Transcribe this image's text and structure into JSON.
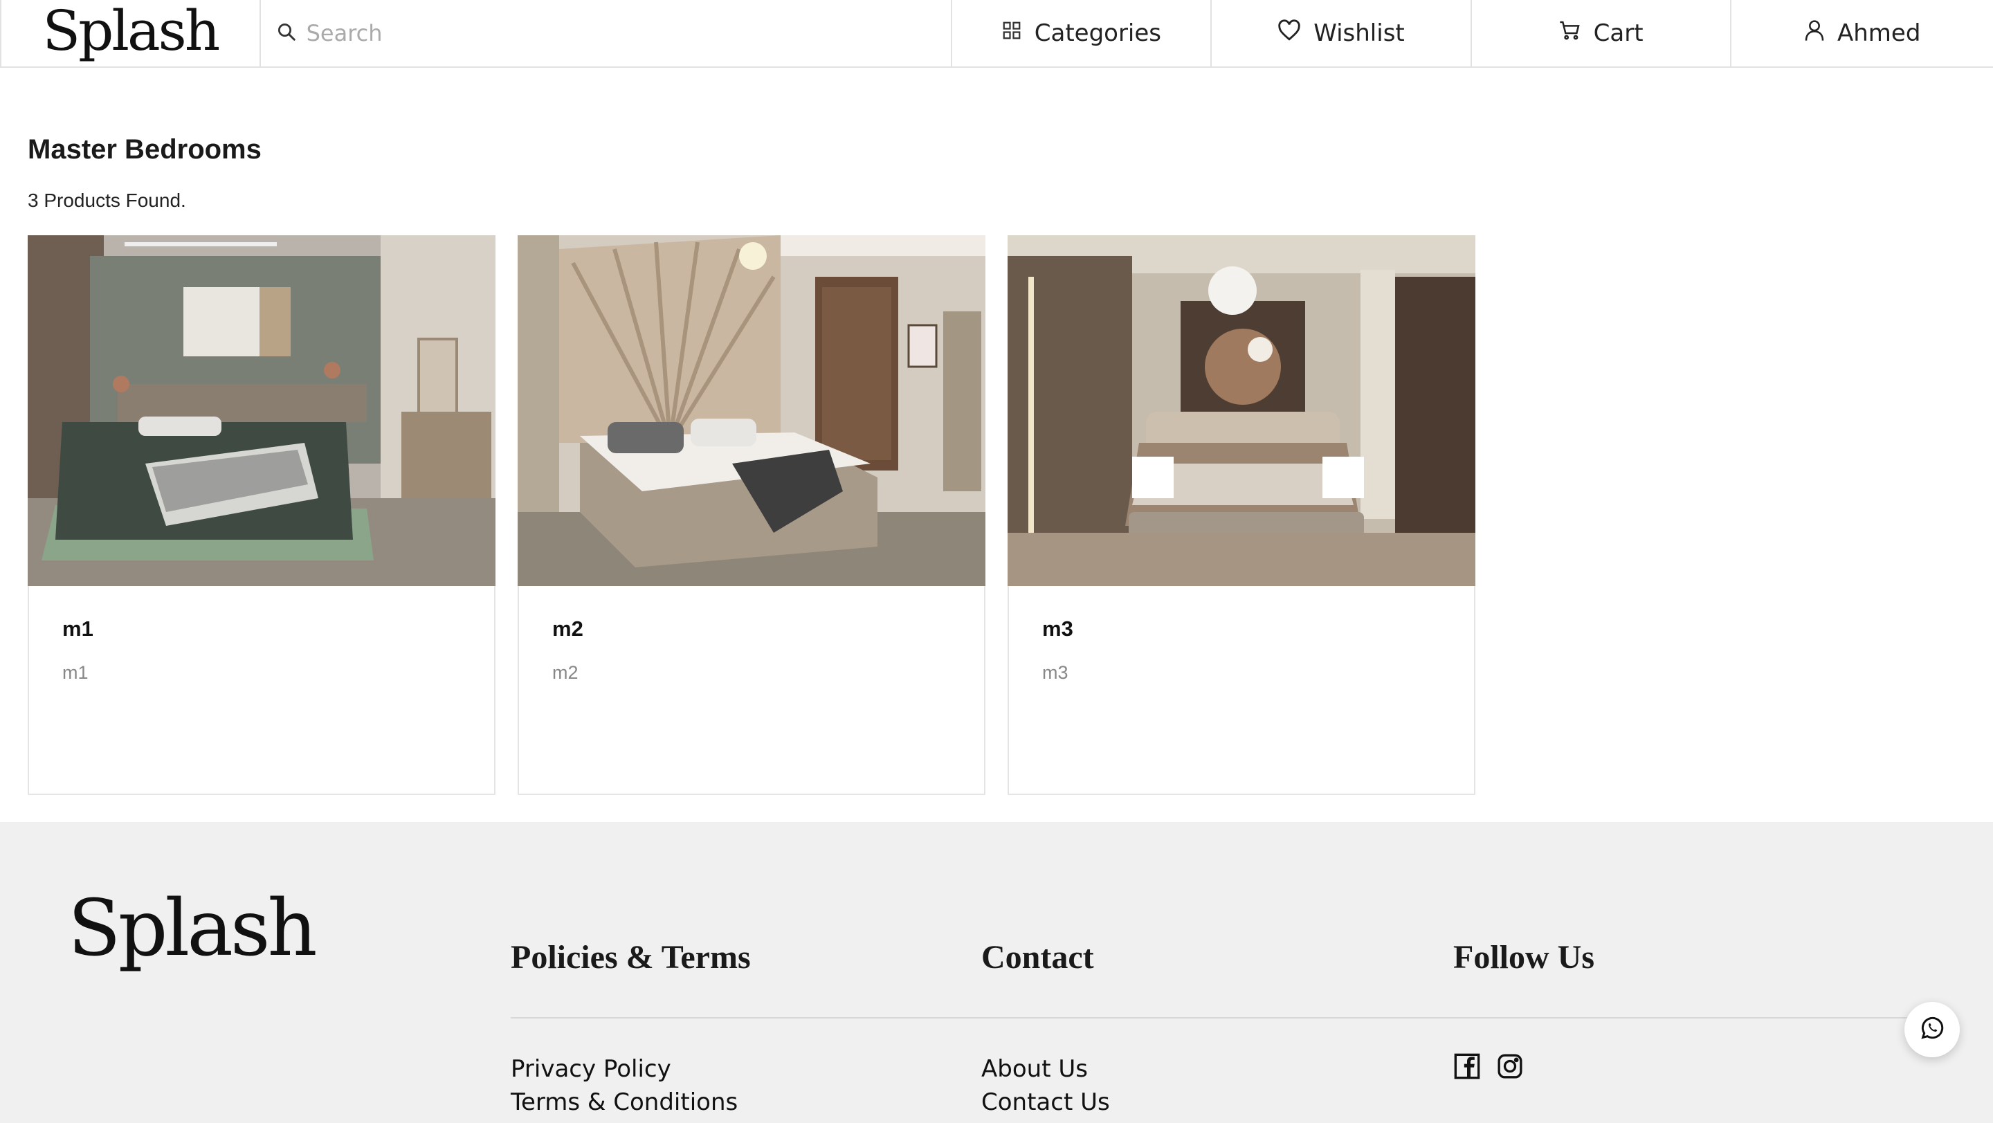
{
  "brand": {
    "logo_text": "Splash"
  },
  "header": {
    "search_placeholder": "Search",
    "nav": [
      {
        "label": "Categories",
        "icon": "grid-icon"
      },
      {
        "label": "Wishlist",
        "icon": "heart-icon"
      },
      {
        "label": "Cart",
        "icon": "cart-icon"
      },
      {
        "label": "Ahmed",
        "icon": "user-icon"
      }
    ]
  },
  "main": {
    "title": "Master Bedrooms",
    "count_text": "3 Products Found.",
    "products": [
      {
        "title": "m1",
        "subtitle": "m1",
        "image": "bedroom photo with green bedding"
      },
      {
        "title": "m2",
        "subtitle": "m2",
        "image": "bedroom photo with beige panelled headboard"
      },
      {
        "title": "m3",
        "subtitle": "m3",
        "image": "bedroom photo with brown wood panels and chandelier"
      }
    ]
  },
  "footer": {
    "logo_text": "Splash",
    "columns": {
      "policies": {
        "heading": "Policies & Terms",
        "links": [
          "Privacy Policy",
          "Terms & Conditions"
        ]
      },
      "contact": {
        "heading": "Contact",
        "links": [
          "About Us",
          "Contact Us"
        ]
      },
      "follow": {
        "heading": "Follow Us",
        "icons": [
          "facebook-icon",
          "instagram-icon"
        ]
      }
    }
  },
  "floating": {
    "icon": "whatsapp-icon"
  }
}
